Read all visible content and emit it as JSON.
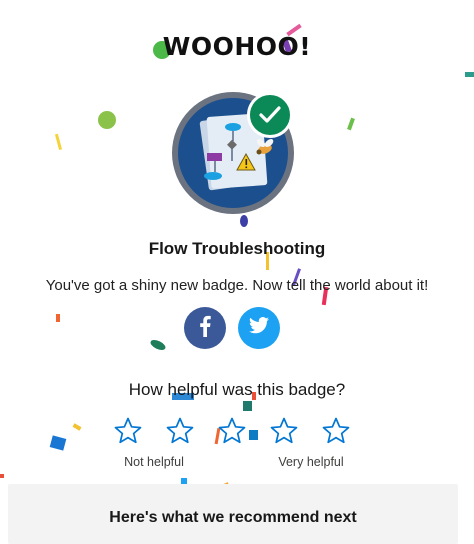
{
  "modal": {
    "headline": "WOOHOO!",
    "badge_title": "Flow Troubleshooting",
    "badge_subtitle": "You've got a shiny new badge. Now tell the world about it!",
    "badge_icon": "flow-diagram-badge-icon",
    "completed_icon": "checkmark-icon"
  },
  "share": {
    "facebook_icon": "facebook-icon",
    "twitter_icon": "twitter-icon"
  },
  "feedback": {
    "question": "How helpful was this badge?",
    "star_count": 5,
    "low_label": "Not helpful",
    "high_label": "Very helpful"
  },
  "recommend": {
    "title": "Here's what we recommend next"
  },
  "colors": {
    "badge_ring": "#6b7280",
    "badge_blue": "#1b4f8e",
    "check_green": "#0b8a57",
    "facebook": "#3b5998",
    "twitter": "#1da1f2",
    "star_outline": "#0176d3"
  }
}
